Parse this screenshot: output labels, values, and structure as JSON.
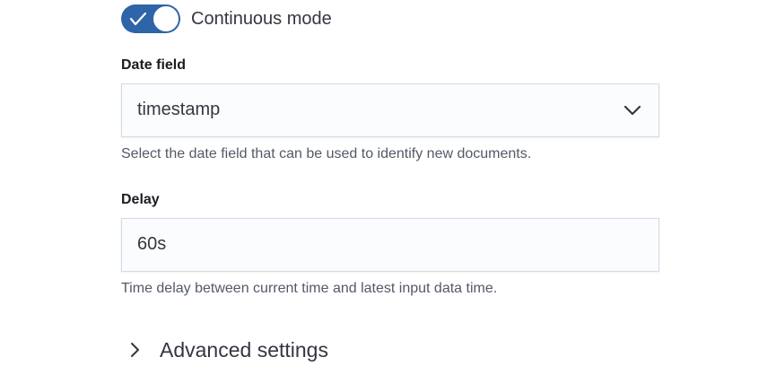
{
  "continuous_mode": {
    "label": "Continuous mode",
    "enabled": true,
    "icon": "check-icon"
  },
  "date_field": {
    "label": "Date field",
    "selected": "timestamp",
    "help": "Select the date field that can be used to identify new documents.",
    "icon": "chevron-down-icon"
  },
  "delay": {
    "label": "Delay",
    "value": "60s",
    "help": "Time delay between current time and latest input data time."
  },
  "advanced": {
    "label": "Advanced settings",
    "icon": "chevron-right-icon"
  },
  "colors": {
    "accent": "#2e64a8",
    "text": "#343741",
    "help_text": "#535966",
    "field_bg": "#fbfcfd",
    "field_border": "#d3dae6"
  }
}
